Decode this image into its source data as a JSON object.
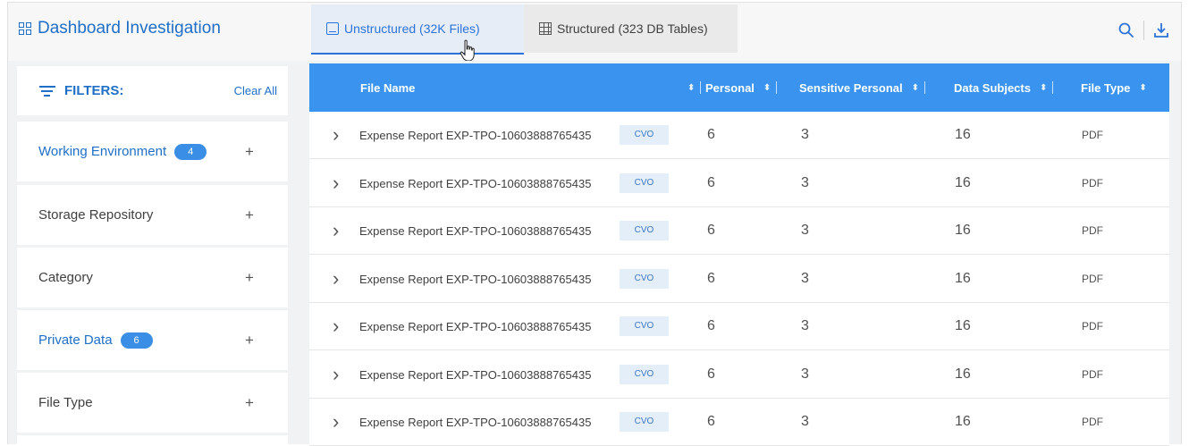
{
  "app": {
    "title": "Dashboard Investigation"
  },
  "tabs": [
    {
      "label": "Unstructured (32K Files)",
      "icon": "document-icon",
      "active": true
    },
    {
      "label": "Structured (323 DB Tables)",
      "icon": "table-icon",
      "active": false
    }
  ],
  "actions": [
    {
      "icon": "search-icon"
    },
    {
      "icon": "download-icon"
    }
  ],
  "filters": {
    "title": "FILTERS:",
    "clear_label": "Clear All",
    "items": [
      {
        "label": "Working Environment",
        "badge": "4",
        "active": true
      },
      {
        "label": "Storage Repository",
        "badge": null,
        "active": false
      },
      {
        "label": "Category",
        "badge": null,
        "active": false
      },
      {
        "label": "Private Data",
        "badge": "6",
        "active": true
      },
      {
        "label": "File Type",
        "badge": null,
        "active": false
      }
    ]
  },
  "table": {
    "columns": [
      "File Name",
      "Personal",
      "Sensitive Personal",
      "Data Subjects",
      "File Type"
    ],
    "rows": [
      {
        "name": "Expense Report EXP-TPO-10603888765435",
        "tag": "CVO",
        "personal": "6",
        "sensitive": "3",
        "subjects": "16",
        "type": "PDF"
      },
      {
        "name": "Expense Report EXP-TPO-10603888765435",
        "tag": "CVO",
        "personal": "6",
        "sensitive": "3",
        "subjects": "16",
        "type": "PDF"
      },
      {
        "name": "Expense Report EXP-TPO-10603888765435",
        "tag": "CVO",
        "personal": "6",
        "sensitive": "3",
        "subjects": "16",
        "type": "PDF"
      },
      {
        "name": "Expense Report EXP-TPO-10603888765435",
        "tag": "CVO",
        "personal": "6",
        "sensitive": "3",
        "subjects": "16",
        "type": "PDF"
      },
      {
        "name": "Expense Report EXP-TPO-10603888765435",
        "tag": "CVO",
        "personal": "6",
        "sensitive": "3",
        "subjects": "16",
        "type": "PDF"
      },
      {
        "name": "Expense Report EXP-TPO-10603888765435",
        "tag": "CVO",
        "personal": "6",
        "sensitive": "3",
        "subjects": "16",
        "type": "PDF"
      },
      {
        "name": "Expense Report EXP-TPO-10603888765435",
        "tag": "CVO",
        "personal": "6",
        "sensitive": "3",
        "subjects": "16",
        "type": "PDF"
      }
    ]
  },
  "colors": {
    "accent": "#1f6fc7",
    "header": "#3a94ef",
    "badge": "#3a8ee6"
  }
}
